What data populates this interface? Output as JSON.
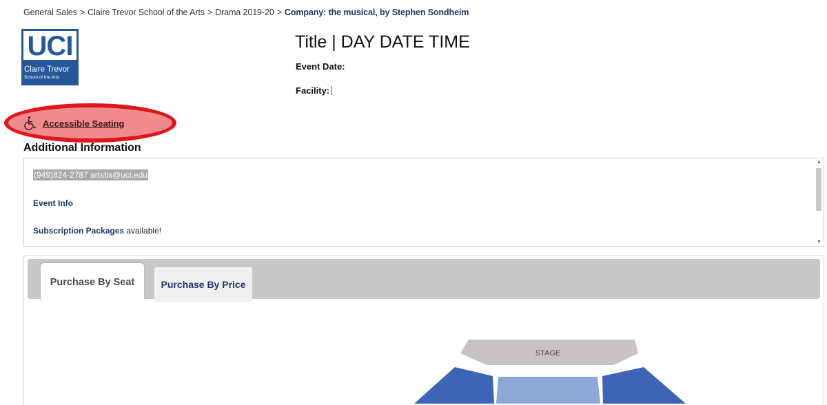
{
  "breadcrumb": {
    "items": [
      "General Sales",
      "Claire Trevor School of the Arts",
      "Drama 2019-20"
    ],
    "current": "Company: the musical, by Stephen Sondheim",
    "separator": ">"
  },
  "logo": {
    "main": "UCI",
    "line1": "Claire Trevor",
    "line2": "School of the Arts",
    "brand_color": "#26579a"
  },
  "event": {
    "title": "Title | DAY DATE TIME",
    "date_label": "Event Date:",
    "facility_label": "Facility:"
  },
  "accessible": {
    "label": "Accessible Seating",
    "icon": "wheelchair-icon",
    "highlight_color": "#e1151b"
  },
  "additional": {
    "heading": "Additional Information",
    "contact": "(949)824-2787 artstix@uci.edu",
    "event_info": "Event Info",
    "subscription_bold": "Subscription Packages",
    "subscription_rest": " available!"
  },
  "tabs": {
    "seat": "Purchase By Seat",
    "price": "Purchase By Price"
  },
  "seatmap": {
    "stage_label": "STAGE",
    "stage_color": "#cbc3c3",
    "section_color": "#3e64b5",
    "center_color": "#8da7d6"
  }
}
